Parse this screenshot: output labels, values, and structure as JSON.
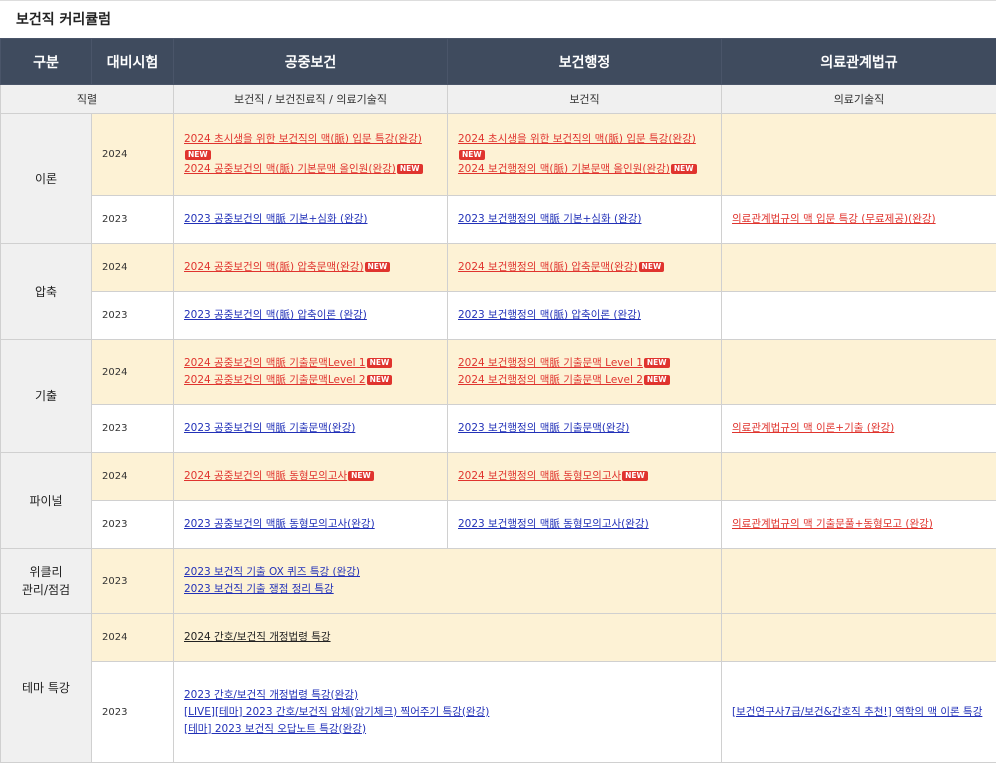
{
  "title": "보건직 커리큘럼",
  "new_badge": "NEW",
  "header": {
    "col_category": "구분",
    "col_exam": "대비시험",
    "col_public_health": "공중보건",
    "col_health_admin": "보건행정",
    "col_medical_law": "의료관계법규"
  },
  "subheader": {
    "label": "직렬",
    "public_health": "보건직 / 보건진료직 / 의료기술직",
    "health_admin": "보건직",
    "medical_law": "의료기술직"
  },
  "rows": {
    "theory": {
      "category": "이론",
      "y2024": {
        "year": "2024",
        "ph": [
          "2024 초시생을 위한 보건직의 맥(脈) 입문 특강(완강)",
          "2024 공중보건의 맥(脈) 기본문맥 올인원(완강)"
        ],
        "ha": [
          "2024 초시생을 위한 보건직의 맥(脈) 입문 특강(완강)",
          "2024 보건행정의 맥(脈) 기본문맥 올인원(완강)"
        ]
      },
      "y2023": {
        "year": "2023",
        "ph": [
          "2023 공중보건의 맥脈 기본+심화 (완강)"
        ],
        "ha": [
          "2023 보건행정의 맥脈 기본+심화 (완강)"
        ],
        "ml": [
          "의료관계법규의 맥 입문 특강 (무료제공)(완강)"
        ]
      }
    },
    "compress": {
      "category": "압축",
      "y2024": {
        "year": "2024",
        "ph": [
          "2024 공중보건의 맥(脈) 압축문맥(완강)"
        ],
        "ha": [
          "2024 보건행정의 맥(脈) 압축문맥(완강)"
        ]
      },
      "y2023": {
        "year": "2023",
        "ph": [
          "2023 공중보건의 맥(脈) 압축이론 (완강)"
        ],
        "ha": [
          "2023 보건행정의 맥(脈) 압축이론 (완강)"
        ]
      }
    },
    "past": {
      "category": "기출",
      "y2024": {
        "year": "2024",
        "ph": [
          "2024 공중보건의 맥脈 기출문맥Level 1",
          "2024 공중보건의 맥脈 기출문맥Level 2"
        ],
        "ha": [
          "2024 보건행정의 맥脈 기출문맥 Level 1",
          "2024 보건행정의 맥脈 기출문맥 Level 2"
        ]
      },
      "y2023": {
        "year": "2023",
        "ph": [
          "2023 공중보건의 맥脈 기출문맥(완강)"
        ],
        "ha": [
          "2023 보건행정의 맥脈 기출문맥(완강)"
        ],
        "ml": [
          "의료관계법규의 맥 이론+기출 (완강)"
        ]
      }
    },
    "final": {
      "category": "파이널",
      "y2024": {
        "year": "2024",
        "ph": [
          "2024 공중보건의 맥脈 동형모의고사"
        ],
        "ha": [
          "2024 보건행정의 맥脈 동형모의고사"
        ]
      },
      "y2023": {
        "year": "2023",
        "ph": [
          "2023 공중보건의 맥脈 동형모의고사(완강)"
        ],
        "ha": [
          "2023 보건행정의 맥脈 동형모의고사(완강)"
        ],
        "ml": [
          "의료관계법규의 맥 기출문풀+동형모고 (완강)"
        ]
      }
    },
    "weekly": {
      "category_line1": "위클리",
      "category_line2": "관리/점검",
      "y2023": {
        "year": "2023",
        "links": [
          "2023 보건직 기출 OX 퀴즈 특강 (완강)",
          "2023 보건직 기출 쟁점 정리 특강"
        ]
      }
    },
    "theme": {
      "category": "테마 특강",
      "y2024": {
        "year": "2024",
        "links": [
          "2024 간호/보건직 개정법령 특강"
        ]
      },
      "y2023": {
        "year": "2023",
        "links": [
          "2023 간호/보건직 개정법령 특강(완강)",
          "[LIVE][테마] 2023 간호/보건직 암체(암기체크) 찍어주기 특강(완강)",
          "[테마] 2023 보건직 오답노트 특강(완강)"
        ],
        "ml": [
          "[보건연구사7급/보건&간호직 추천!] 역학의 맥 이론 특강"
        ]
      }
    }
  }
}
